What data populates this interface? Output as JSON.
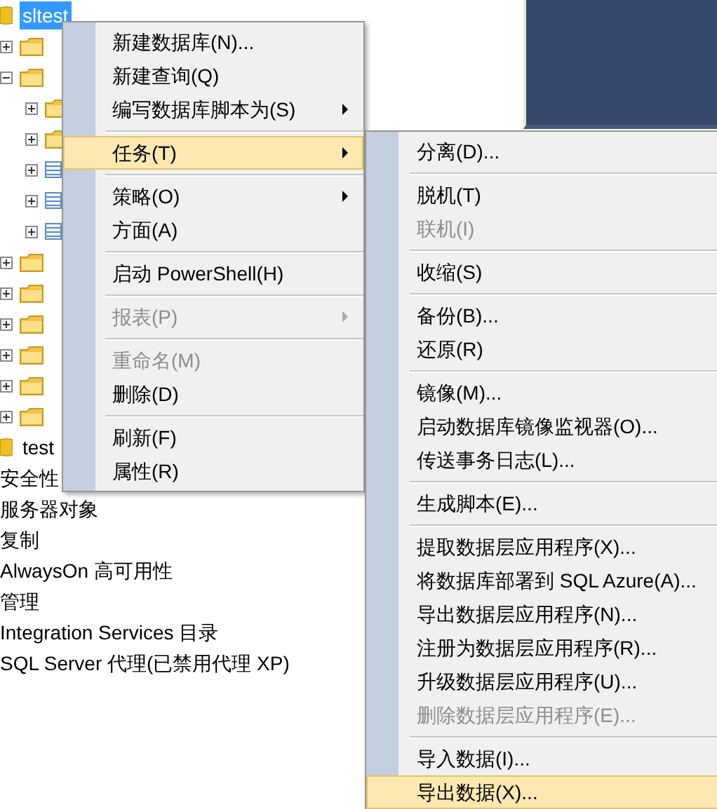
{
  "tree": [
    {
      "label": "sltest",
      "kind": "database",
      "selected": true,
      "children": [
        {
          "kind": "folder",
          "expanded": false
        },
        {
          "kind": "folder",
          "expanded": true,
          "children": [
            {
              "kind": "folder",
              "expanded": false
            },
            {
              "kind": "folder",
              "expanded": false
            },
            {
              "kind": "table",
              "expanded": false
            },
            {
              "kind": "table",
              "expanded": false
            },
            {
              "kind": "table",
              "expanded": false
            }
          ]
        },
        {
          "kind": "folder",
          "expanded": false
        },
        {
          "kind": "folder",
          "expanded": false
        },
        {
          "kind": "folder",
          "expanded": false
        },
        {
          "kind": "folder",
          "expanded": false
        },
        {
          "kind": "folder",
          "expanded": false
        },
        {
          "kind": "folder",
          "expanded": false
        }
      ]
    },
    {
      "label": "test",
      "kind": "database",
      "selected": false
    }
  ],
  "server_nodes": [
    "安全性",
    "服务器对象",
    "复制",
    "AlwaysOn 高可用性",
    "管理",
    "Integration Services 目录",
    "SQL Server 代理(已禁用代理 XP)"
  ],
  "context_menu": [
    {
      "kind": "item",
      "label": "新建数据库(N)...",
      "submenu": false,
      "disabled": false,
      "selected": false
    },
    {
      "kind": "item",
      "label": "新建查询(Q)",
      "submenu": false,
      "disabled": false,
      "selected": false
    },
    {
      "kind": "item",
      "label": "编写数据库脚本为(S)",
      "submenu": true,
      "disabled": false,
      "selected": false
    },
    {
      "kind": "separator"
    },
    {
      "kind": "item",
      "label": "任务(T)",
      "submenu": true,
      "disabled": false,
      "selected": true
    },
    {
      "kind": "separator"
    },
    {
      "kind": "item",
      "label": "策略(O)",
      "submenu": true,
      "disabled": false,
      "selected": false
    },
    {
      "kind": "item",
      "label": "方面(A)",
      "submenu": false,
      "disabled": false,
      "selected": false
    },
    {
      "kind": "separator"
    },
    {
      "kind": "item",
      "label": "启动 PowerShell(H)",
      "submenu": false,
      "disabled": false,
      "selected": false
    },
    {
      "kind": "separator"
    },
    {
      "kind": "item",
      "label": "报表(P)",
      "submenu": true,
      "disabled": true,
      "selected": false
    },
    {
      "kind": "separator"
    },
    {
      "kind": "item",
      "label": "重命名(M)",
      "submenu": false,
      "disabled": true,
      "selected": false
    },
    {
      "kind": "item",
      "label": "删除(D)",
      "submenu": false,
      "disabled": false,
      "selected": false
    },
    {
      "kind": "separator"
    },
    {
      "kind": "item",
      "label": "刷新(F)",
      "submenu": false,
      "disabled": false,
      "selected": false
    },
    {
      "kind": "item",
      "label": "属性(R)",
      "submenu": false,
      "disabled": false,
      "selected": false
    }
  ],
  "tasks_submenu": [
    {
      "kind": "item",
      "label": "分离(D)...",
      "disabled": false,
      "selected": false
    },
    {
      "kind": "separator"
    },
    {
      "kind": "item",
      "label": "脱机(T)",
      "disabled": false,
      "selected": false
    },
    {
      "kind": "item",
      "label": "联机(I)",
      "disabled": true,
      "selected": false
    },
    {
      "kind": "separator"
    },
    {
      "kind": "item",
      "label": "收缩(S)",
      "disabled": false,
      "selected": false
    },
    {
      "kind": "separator"
    },
    {
      "kind": "item",
      "label": "备份(B)...",
      "disabled": false,
      "selected": false
    },
    {
      "kind": "item",
      "label": "还原(R)",
      "disabled": false,
      "selected": false
    },
    {
      "kind": "separator"
    },
    {
      "kind": "item",
      "label": "镜像(M)...",
      "disabled": false,
      "selected": false
    },
    {
      "kind": "item",
      "label": "启动数据库镜像监视器(O)...",
      "disabled": false,
      "selected": false
    },
    {
      "kind": "item",
      "label": "传送事务日志(L)...",
      "disabled": false,
      "selected": false
    },
    {
      "kind": "separator"
    },
    {
      "kind": "item",
      "label": "生成脚本(E)...",
      "disabled": false,
      "selected": false
    },
    {
      "kind": "separator"
    },
    {
      "kind": "item",
      "label": "提取数据层应用程序(X)...",
      "disabled": false,
      "selected": false
    },
    {
      "kind": "item",
      "label": "将数据库部署到 SQL Azure(A)...",
      "disabled": false,
      "selected": false
    },
    {
      "kind": "item",
      "label": "导出数据层应用程序(N)...",
      "disabled": false,
      "selected": false
    },
    {
      "kind": "item",
      "label": "注册为数据层应用程序(R)...",
      "disabled": false,
      "selected": false
    },
    {
      "kind": "item",
      "label": "升级数据层应用程序(U)...",
      "disabled": false,
      "selected": false
    },
    {
      "kind": "item",
      "label": "删除数据层应用程序(E)...",
      "disabled": true,
      "selected": false
    },
    {
      "kind": "separator"
    },
    {
      "kind": "item",
      "label": "导入数据(I)...",
      "disabled": false,
      "selected": false
    },
    {
      "kind": "item",
      "label": "导出数据(X)...",
      "disabled": false,
      "selected": true
    }
  ]
}
